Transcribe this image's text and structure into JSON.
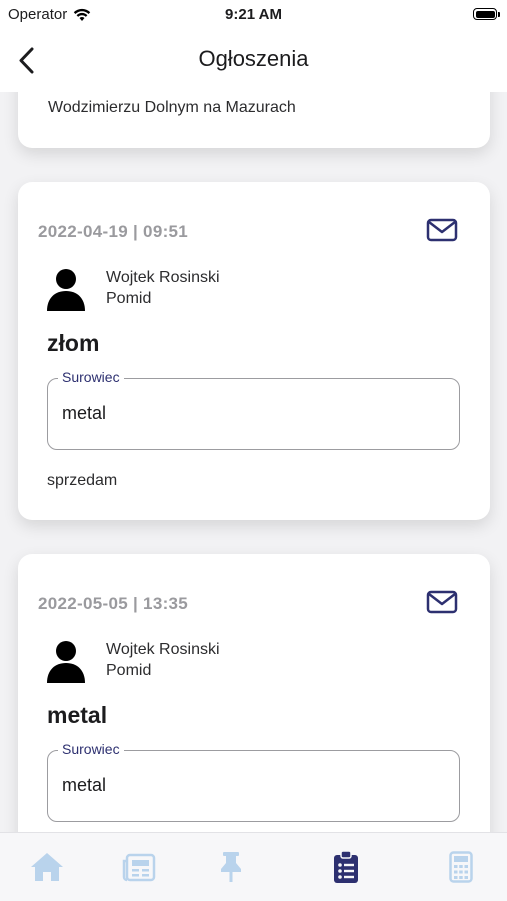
{
  "status_bar": {
    "carrier": "Operator",
    "time": "9:21 AM"
  },
  "nav": {
    "title": "Ogłoszenia"
  },
  "previous_card": {
    "text_line": "Wodzimierzu Dolnym na Mazurach"
  },
  "announcements": [
    {
      "date": "2022-04-19 | 09:51",
      "user_name": "Wojtek Rosinski",
      "company": "Pomid",
      "title": "złom",
      "field_label": "Surowiec",
      "field_value": "metal",
      "description": "sprzedam"
    },
    {
      "date": "2022-05-05 | 13:35",
      "user_name": "Wojtek Rosinski",
      "company": "Pomid",
      "title": "metal",
      "field_label": "Surowiec",
      "field_value": "metal"
    }
  ],
  "tabs": {
    "active": "announcements",
    "items": [
      "home-icon",
      "news-icon",
      "pin-icon",
      "clipboard-list-icon",
      "calculator-icon"
    ]
  },
  "colors": {
    "accent": "#2d3070",
    "inactive_tab": "#b9d3ec",
    "date_gray": "#9a9a9e"
  }
}
